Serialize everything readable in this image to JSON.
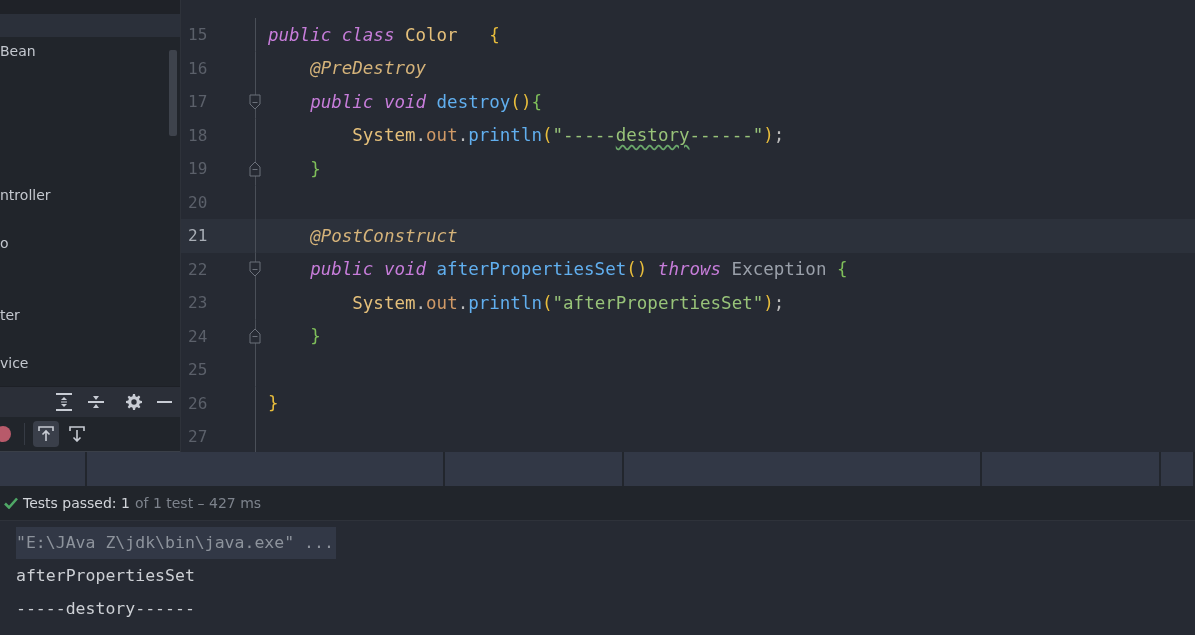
{
  "project_tree": {
    "items": [
      {
        "label": "Bean"
      },
      {
        "label": "ntroller"
      },
      {
        "label": "o"
      },
      {
        "label": "ter"
      },
      {
        "label": "vice"
      }
    ]
  },
  "run_toolbar": {
    "toggles": [
      {
        "on": true
      },
      {
        "on": false
      }
    ]
  },
  "editor": {
    "lines": [
      {
        "number": "15",
        "current": false,
        "tokens": [
          {
            "text": "public",
            "kind": "keyword"
          },
          {
            "text": " class",
            "kind": "keyword"
          },
          {
            "text": " Color   ",
            "kind": "classname"
          },
          {
            "text": "{",
            "kind": "outer"
          }
        ]
      },
      {
        "number": "16",
        "current": false,
        "tokens": [
          {
            "text": "    @PreDestroy",
            "kind": "annotation"
          }
        ]
      },
      {
        "number": "17",
        "current": false,
        "fold_start": true,
        "tokens": [
          {
            "text": "    public",
            "kind": "keyword"
          },
          {
            "text": " void",
            "kind": "keyword"
          },
          {
            "text": " destroy",
            "kind": "method"
          },
          {
            "text": "()",
            "kind": "outer"
          },
          {
            "text": "{",
            "kind": "inner"
          }
        ]
      },
      {
        "number": "18",
        "current": false,
        "tokens": [
          {
            "text": "        System",
            "kind": "classname"
          },
          {
            "text": ".",
            "kind": "plain"
          },
          {
            "text": "out",
            "kind": "field"
          },
          {
            "text": ".",
            "kind": "plain"
          },
          {
            "text": "println",
            "kind": "method"
          },
          {
            "text": "(",
            "kind": "outer"
          },
          {
            "text": "\"-----",
            "kind": "string"
          },
          {
            "text": "destory",
            "kind": "string",
            "misspelled": true
          },
          {
            "text": "------\"",
            "kind": "string"
          },
          {
            "text": ")",
            "kind": "outer"
          },
          {
            "text": ";",
            "kind": "plain"
          }
        ]
      },
      {
        "number": "19",
        "current": false,
        "fold_end": true,
        "tokens": [
          {
            "text": "    }",
            "kind": "inner"
          }
        ]
      },
      {
        "number": "20",
        "current": false
      },
      {
        "number": "21",
        "current": true,
        "tokens": [
          {
            "text": "    @PostConstruct",
            "kind": "annotation"
          }
        ]
      },
      {
        "number": "22",
        "current": false,
        "fold_start": true,
        "tokens": [
          {
            "text": "    public",
            "kind": "keyword"
          },
          {
            "text": " void",
            "kind": "keyword"
          },
          {
            "text": " afterPropertiesSet",
            "kind": "method"
          },
          {
            "text": "()",
            "kind": "outer"
          },
          {
            "text": " throws",
            "kind": "keyword"
          },
          {
            "text": " Exception ",
            "kind": "type"
          },
          {
            "text": "{",
            "kind": "inner"
          }
        ]
      },
      {
        "number": "23",
        "current": false,
        "tokens": [
          {
            "text": "        System",
            "kind": "classname"
          },
          {
            "text": ".",
            "kind": "plain"
          },
          {
            "text": "out",
            "kind": "field"
          },
          {
            "text": ".",
            "kind": "plain"
          },
          {
            "text": "println",
            "kind": "method"
          },
          {
            "text": "(",
            "kind": "outer"
          },
          {
            "text": "\"afterPropertiesSet\"",
            "kind": "string"
          },
          {
            "text": ")",
            "kind": "outer"
          },
          {
            "text": ";",
            "kind": "plain"
          }
        ]
      },
      {
        "number": "24",
        "current": false,
        "fold_end": true,
        "tokens": [
          {
            "text": "    }",
            "kind": "inner"
          }
        ]
      },
      {
        "number": "25",
        "current": false
      },
      {
        "number": "26",
        "current": false,
        "tokens": [
          {
            "text": "}",
            "kind": "outer"
          }
        ]
      },
      {
        "number": "27",
        "current": false
      }
    ]
  },
  "test_status": {
    "passed": true,
    "summary": "Tests passed: 1",
    "detail": "of 1 test – 427 ms"
  },
  "console": {
    "lines": [
      {
        "text": "\"E:\\JAva Z\\jdk\\bin\\java.exe\" ...",
        "kind": "command"
      },
      {
        "text": "afterPropertiesSet",
        "kind": "output"
      },
      {
        "text": "-----destory------",
        "kind": "output"
      }
    ]
  }
}
